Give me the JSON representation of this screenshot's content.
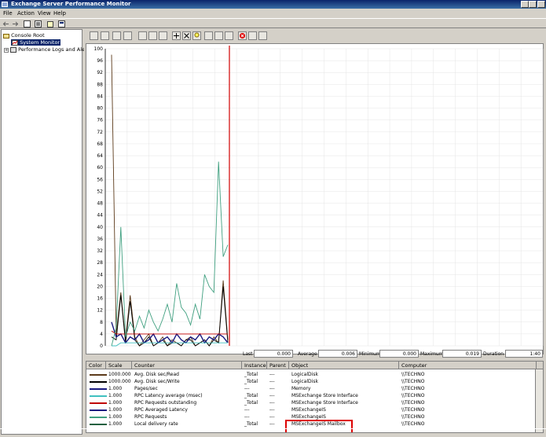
{
  "window": {
    "title": "Exchange Server Performance Monitor"
  },
  "menu": [
    "File",
    "Action",
    "View",
    "Help"
  ],
  "tree": {
    "root": "Console Root",
    "items": [
      "System Monitor",
      "Performance Logs and Alerts"
    ]
  },
  "chart_data": {
    "type": "line",
    "ylim": [
      0,
      100
    ],
    "yticks": [
      "100",
      "96",
      "92",
      "88",
      "84",
      "80",
      "76",
      "72",
      "68",
      "64",
      "60",
      "56",
      "52",
      "48",
      "44",
      "40",
      "36",
      "32",
      "28",
      "24",
      "20",
      "16",
      "12",
      "8",
      "4",
      "0"
    ],
    "series": [
      {
        "name": "Avg. Disk sec/Read",
        "color": "#5c3a1a",
        "values": [
          98,
          4,
          18,
          2,
          17,
          3,
          0,
          2,
          4,
          0,
          1,
          3,
          0,
          2,
          1,
          0,
          2,
          3,
          0,
          1,
          2,
          0,
          3,
          1,
          22,
          2
        ]
      },
      {
        "name": "Avg. Disk sec/Write",
        "color": "#000000",
        "values": [
          3,
          2,
          17,
          1,
          15,
          2,
          0,
          1,
          3,
          0,
          1,
          2,
          0,
          1,
          1,
          0,
          2,
          2,
          0,
          1,
          2,
          0,
          2,
          1,
          20,
          1
        ]
      },
      {
        "name": "Pages/sec",
        "color": "#1a1a80",
        "values": [
          8,
          3,
          4,
          1,
          3,
          2,
          4,
          1,
          2,
          4,
          1,
          2,
          3,
          1,
          4,
          2,
          1,
          3,
          2,
          4,
          1,
          3,
          2,
          4,
          3,
          1
        ]
      },
      {
        "name": "RPC Latency average (msec)",
        "color": "#40c0c0",
        "values": [
          0,
          0,
          1,
          1,
          1,
          1,
          1,
          1,
          1,
          1,
          1,
          1,
          1,
          1,
          1,
          1,
          1,
          1,
          1,
          1,
          1,
          1,
          1,
          1,
          1,
          1
        ]
      },
      {
        "name": "RPC Requests outstanding",
        "color": "#c00000",
        "values": [
          5,
          4,
          4,
          4,
          4,
          4,
          4,
          4,
          4,
          4,
          4,
          4,
          4,
          4,
          4,
          4,
          4,
          4,
          4,
          4,
          4,
          4,
          4,
          4,
          4,
          4
        ]
      },
      {
        "name": "RPC Requests",
        "color": "#40a080",
        "values": [
          0,
          6,
          40,
          3,
          8,
          5,
          10,
          6,
          12,
          8,
          5,
          9,
          14,
          8,
          21,
          13,
          11,
          7,
          14,
          9,
          24,
          20,
          18,
          62,
          30,
          34
        ]
      }
    ],
    "time_marker_index": 25
  },
  "stats": {
    "last_label": "Last",
    "last": "0.000",
    "average_label": "Average",
    "average": "0.006",
    "minimum_label": "Minimum",
    "minimum": "0.000",
    "maximum_label": "Maximum",
    "maximum": "0.019",
    "duration_label": "Duration",
    "duration": "1:40"
  },
  "legend": {
    "headers": [
      "Color",
      "Scale",
      "Counter",
      "Instance",
      "Parent",
      "Object",
      "Computer"
    ],
    "rows": [
      {
        "color": "#5c3a1a",
        "scale": "1000.000",
        "counter": "Avg. Disk sec/Read",
        "instance": "_Total",
        "parent": "---",
        "object": "LogicalDisk",
        "computer": "\\\\TECHNO"
      },
      {
        "color": "#000000",
        "scale": "1000.000",
        "counter": "Avg. Disk sec/Write",
        "instance": "_Total",
        "parent": "---",
        "object": "LogicalDisk",
        "computer": "\\\\TECHNO"
      },
      {
        "color": "#1a1a80",
        "scale": "1.000",
        "counter": "Pages/sec",
        "instance": "---",
        "parent": "---",
        "object": "Memory",
        "computer": "\\\\TECHNO"
      },
      {
        "color": "#40c0c0",
        "scale": "1.000",
        "counter": "RPC Latency average (msec)",
        "instance": "_Total",
        "parent": "---",
        "object": "MSExchange Store Interface",
        "computer": "\\\\TECHNO"
      },
      {
        "color": "#c00000",
        "scale": "1.000",
        "counter": "RPC Requests outstanding",
        "instance": "_Total",
        "parent": "---",
        "object": "MSExchange Store Interface",
        "computer": "\\\\TECHNO"
      },
      {
        "color": "#1a1a80",
        "scale": "1.000",
        "counter": "RPC Averaged Latency",
        "instance": "---",
        "parent": "---",
        "object": "MSExchangeIS",
        "computer": "\\\\TECHNO"
      },
      {
        "color": "#40a080",
        "scale": "1.000",
        "counter": "RPC Requests",
        "instance": "---",
        "parent": "---",
        "object": "MSExchangeIS",
        "computer": "\\\\TECHNO"
      },
      {
        "color": "#206040",
        "scale": "1.000",
        "counter": "Local delivery rate",
        "instance": "_Total",
        "parent": "---",
        "object": "MSExchangeIS Mailbox",
        "computer": "\\\\TECHNO"
      }
    ]
  }
}
